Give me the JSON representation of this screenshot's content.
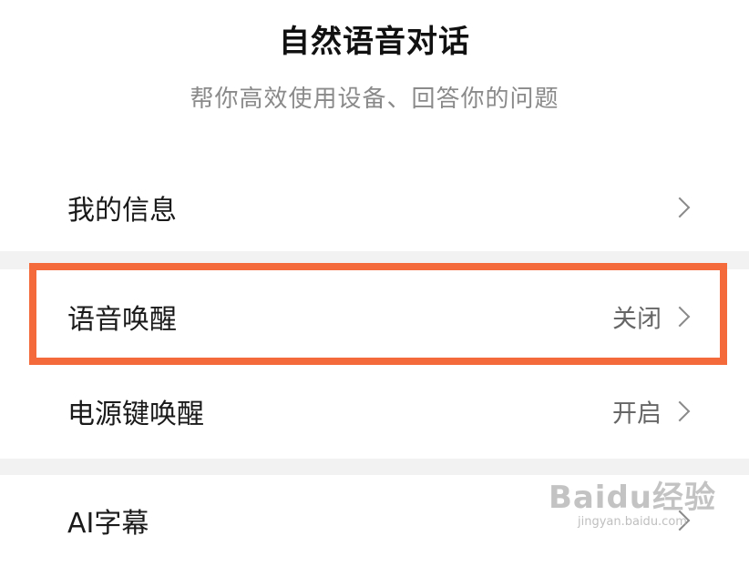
{
  "header": {
    "title": "自然语音对话",
    "subtitle": "帮你高效使用设备、回答你的问题"
  },
  "rows": [
    {
      "label": "我的信息",
      "value": ""
    },
    {
      "label": "语音唤醒",
      "value": "关闭"
    },
    {
      "label": "电源键唤醒",
      "value": "开启"
    },
    {
      "label": "AI字幕",
      "value": ""
    }
  ],
  "watermark": {
    "main": "Baidu经验",
    "sub": "jingyan.baidu.com"
  },
  "colors": {
    "highlight": "#f46a3a",
    "background": "#ffffff",
    "section_gap": "#f2f2f2"
  }
}
